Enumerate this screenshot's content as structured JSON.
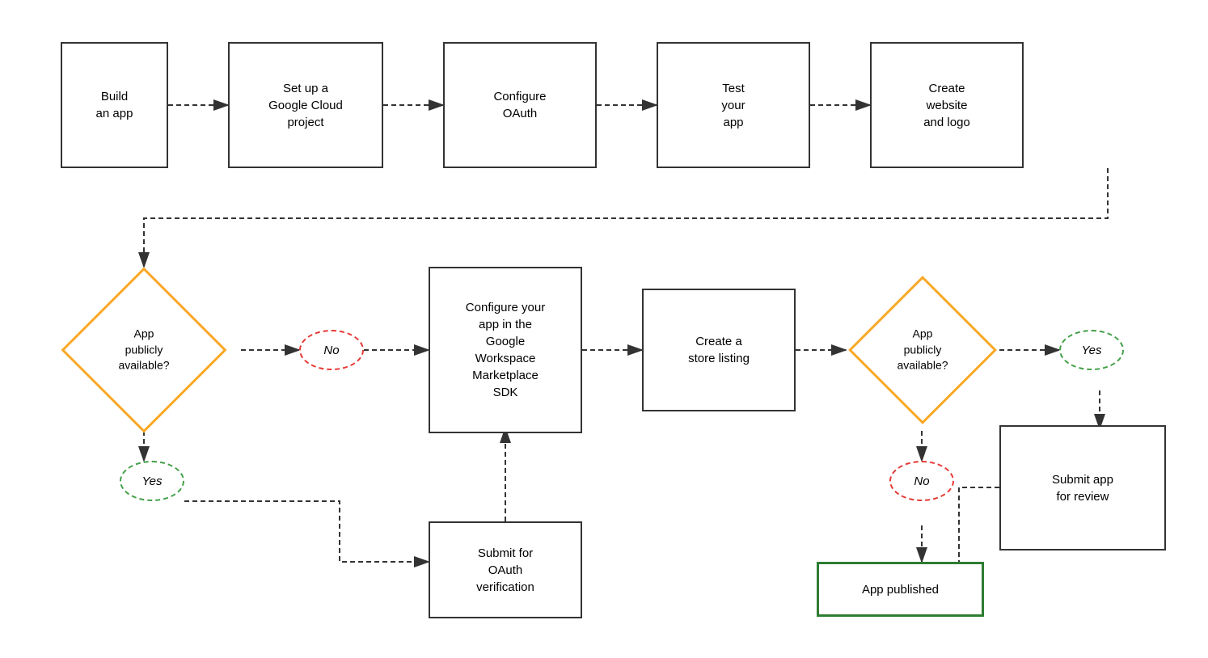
{
  "boxes": {
    "build_app": {
      "label": "Build\nan app"
    },
    "setup_google": {
      "label": "Set up a\nGoogle Cloud\nproject"
    },
    "configure_oauth": {
      "label": "Configure\nOAuth"
    },
    "test_app": {
      "label": "Test\nyour\napp"
    },
    "create_website": {
      "label": "Create\nwebsite\nand logo"
    },
    "configure_workspace": {
      "label": "Configure your\napp in the\nGoogle\nWorkspace\nMarketplace\nSDK"
    },
    "create_store": {
      "label": "Create a\nstore listing"
    },
    "submit_oauth": {
      "label": "Submit for\nOAuth\nverification"
    },
    "submit_review": {
      "label": "Submit app\nfor review"
    },
    "app_published": {
      "label": "App published"
    }
  },
  "diamonds": {
    "app_public_left": {
      "label": "App\npublicly\navailable?"
    },
    "app_public_right": {
      "label": "App\npublicly\navailable?"
    }
  },
  "ovals": {
    "no_left": {
      "label": "No"
    },
    "yes_left": {
      "label": "Yes"
    },
    "yes_right": {
      "label": "Yes"
    },
    "no_right": {
      "label": "No"
    }
  }
}
